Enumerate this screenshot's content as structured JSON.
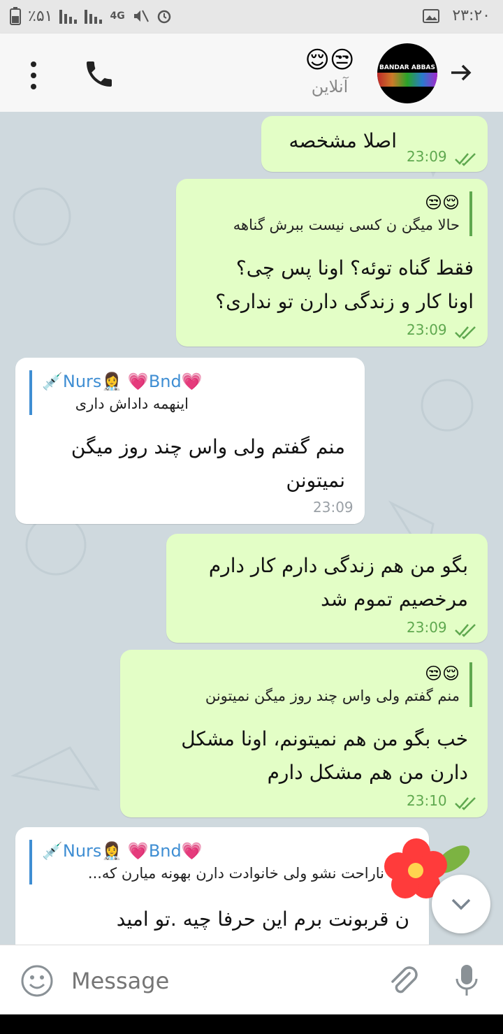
{
  "status": {
    "battery": "٪۵۱",
    "network": "4G",
    "time": "۲۳:۲۰"
  },
  "header": {
    "name_emojis": "😌😒",
    "status": "آنلاین",
    "avatar_text": "BANDAR ABBAS"
  },
  "messages": [
    {
      "text": "اصلا مشخصه",
      "time": "23:09"
    },
    {
      "reply_name": "😌😒",
      "reply_text": "حالا میگن ن کسی نیست ببرش گناهه",
      "text_lines": [
        "فقط گناه توئه؟ اونا پس چی؟",
        "اونا کار و زندگی دارن تو نداری؟"
      ],
      "time": "23:09"
    },
    {
      "reply_name": "💉Nurs👩‍⚕️ 💗Bnd💗",
      "reply_text": "اینهمه داداش داری",
      "text_lines": [
        "منم گفتم ولی واس چند روز میگن",
        "نمیتونن"
      ],
      "time": "23:09"
    },
    {
      "text_lines": [
        "بگو من هم زندگی دارم کار دارم",
        "مرخصیم تموم شد"
      ],
      "time": "23:09"
    },
    {
      "reply_name": "😌😒",
      "reply_text": "منم گفتم ولی واس چند روز میگن نمیتونن",
      "text_lines": [
        "خب بگو من هم نمیتونم، اونا مشکل",
        "دارن من هم مشکل دارم"
      ],
      "time": "23:10"
    },
    {
      "reply_name": "💉Nurs👩‍⚕️ 💗Bnd💗",
      "reply_text": "ناراحت نشو ولی خانوادت دارن بهونه میارن که...",
      "text_lines": [
        "ن قربونت برم این حرفا چیه .تو امید"
      ]
    }
  ],
  "input": {
    "placeholder": "Message"
  },
  "colors": {
    "outgoing": "#e3fec6",
    "incoming": "#ffffff",
    "tick": "#5fa84f",
    "reply_link": "#3f8ed3"
  }
}
